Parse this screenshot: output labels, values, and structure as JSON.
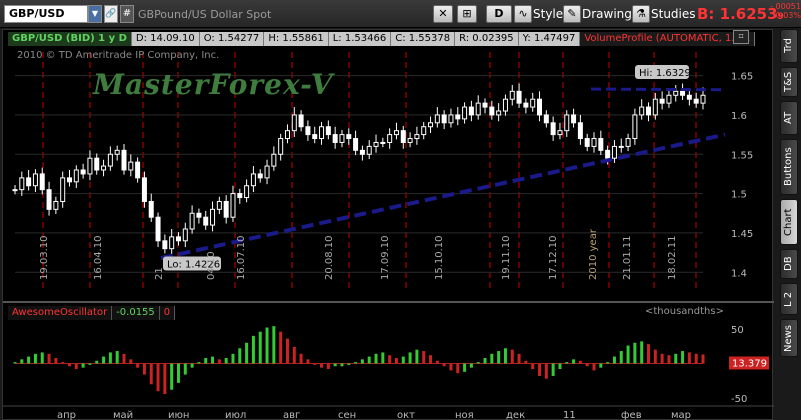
{
  "toolbar": {
    "symbol": "GBP/USD",
    "symbol_description": "GBPound/US Dollar Spot",
    "period": "D",
    "style_label": "Style",
    "drawings_label": "Drawings",
    "studies_label": "Studies",
    "bid_label": "B: 1.6253",
    "bid_suffix": "9",
    "change_abs": "-.00051",
    "change_pct": "-0.03%",
    "symbol_hash": "#"
  },
  "chart_header": {
    "symbol": "GBP/USD (BID) 1 y D",
    "date": "D: 14.09.10",
    "open": "O: 1.54277",
    "high": "H: 1.55861",
    "low": "L: 1.53466",
    "close": "C: 1.55378",
    "range": "R: 0.02395",
    "year": "Y: 1.47497",
    "study": "VolumeProfile (AUTOMATIC, 1.0..."
  },
  "copyright": "2010 © TD Ameritrade IP Company, Inc.",
  "watermark": "MasterForex-V",
  "hi_label": "Hi: 1.6329",
  "lo_label": "Lo: 1.4226",
  "price_axis": [
    "1.65",
    "1.6",
    "1.55",
    "1.5",
    "1.45",
    "1.4"
  ],
  "oscillator": {
    "name": "AwesomeOscillator",
    "value": "-0.0155",
    "zero": "0",
    "units": "<thousandths>",
    "axis": [
      "50",
      "0",
      "-50"
    ],
    "current": "13.379"
  },
  "date_labels": [
    "19.03.10",
    "16.04.10",
    "21",
    "04.10",
    "16.07.10",
    "20.08.10",
    "17.09.10",
    "15.10.10",
    "19.11.10",
    "17.12.10",
    "2010 year",
    "21.01.11",
    "18.02.11"
  ],
  "month_labels": [
    "апр",
    "май",
    "июн",
    "июл",
    "авг",
    "сен",
    "окт",
    "ноя",
    "дек",
    "11",
    "фев",
    "мар"
  ],
  "side_tabs": [
    "Trd",
    "T&S",
    "AT",
    "Buttons",
    "Chart",
    "DB",
    "L 2",
    "News"
  ],
  "colors": {
    "candle_up": "#ffffff",
    "candle_down": "#ffffff",
    "trendline": "#1a1a8a",
    "vline": "#cc0000",
    "osc_up": "#33cc33",
    "osc_down": "#cc2222"
  },
  "chart_data": {
    "type": "candlestick",
    "y_range": [
      1.38,
      1.68
    ],
    "close_path": [
      1.505,
      1.52,
      1.51,
      1.525,
      1.505,
      1.48,
      1.49,
      1.52,
      1.515,
      1.53,
      1.525,
      1.545,
      1.53,
      1.535,
      1.55,
      1.555,
      1.53,
      1.54,
      1.52,
      1.49,
      1.47,
      1.44,
      1.43,
      1.445,
      1.44,
      1.455,
      1.475,
      1.47,
      1.46,
      1.48,
      1.49,
      1.47,
      1.5,
      1.495,
      1.51,
      1.525,
      1.52,
      1.535,
      1.55,
      1.57,
      1.58,
      1.6,
      1.585,
      1.575,
      1.57,
      1.585,
      1.575,
      1.565,
      1.575,
      1.57,
      1.555,
      1.55,
      1.56,
      1.565,
      1.565,
      1.575,
      1.58,
      1.565,
      1.57,
      1.575,
      1.585,
      1.59,
      1.6,
      1.59,
      1.6,
      1.595,
      1.61,
      1.6,
      1.615,
      1.61,
      1.6,
      1.605,
      1.62,
      1.63,
      1.615,
      1.61,
      1.62,
      1.6,
      1.59,
      1.575,
      1.58,
      1.6,
      1.59,
      1.57,
      1.56,
      1.57,
      1.555,
      1.545,
      1.56,
      1.56,
      1.57,
      1.6,
      1.61,
      1.6,
      1.62,
      1.615,
      1.625,
      1.63,
      1.625,
      1.62,
      1.615,
      1.625
    ],
    "oscillator": [
      2,
      6,
      10,
      14,
      16,
      14,
      8,
      2,
      -4,
      -8,
      -6,
      -2,
      4,
      10,
      16,
      18,
      14,
      6,
      -6,
      -16,
      -30,
      -40,
      -44,
      -38,
      -28,
      -16,
      -6,
      2,
      8,
      10,
      6,
      8,
      14,
      22,
      30,
      40,
      46,
      52,
      54,
      46,
      36,
      24,
      14,
      6,
      -2,
      -6,
      -8,
      -4,
      -4,
      -2,
      2,
      6,
      10,
      14,
      16,
      12,
      8,
      10,
      16,
      20,
      18,
      12,
      4,
      -4,
      -10,
      -14,
      -12,
      -6,
      2,
      8,
      14,
      18,
      22,
      20,
      14,
      4,
      -8,
      -18,
      -22,
      -18,
      -8,
      2,
      6,
      4,
      -4,
      -10,
      -6,
      2,
      10,
      18,
      26,
      30,
      32,
      28,
      20,
      14,
      12,
      14,
      18,
      16,
      14,
      13
    ],
    "hi": 1.6329,
    "lo": 1.4226
  }
}
